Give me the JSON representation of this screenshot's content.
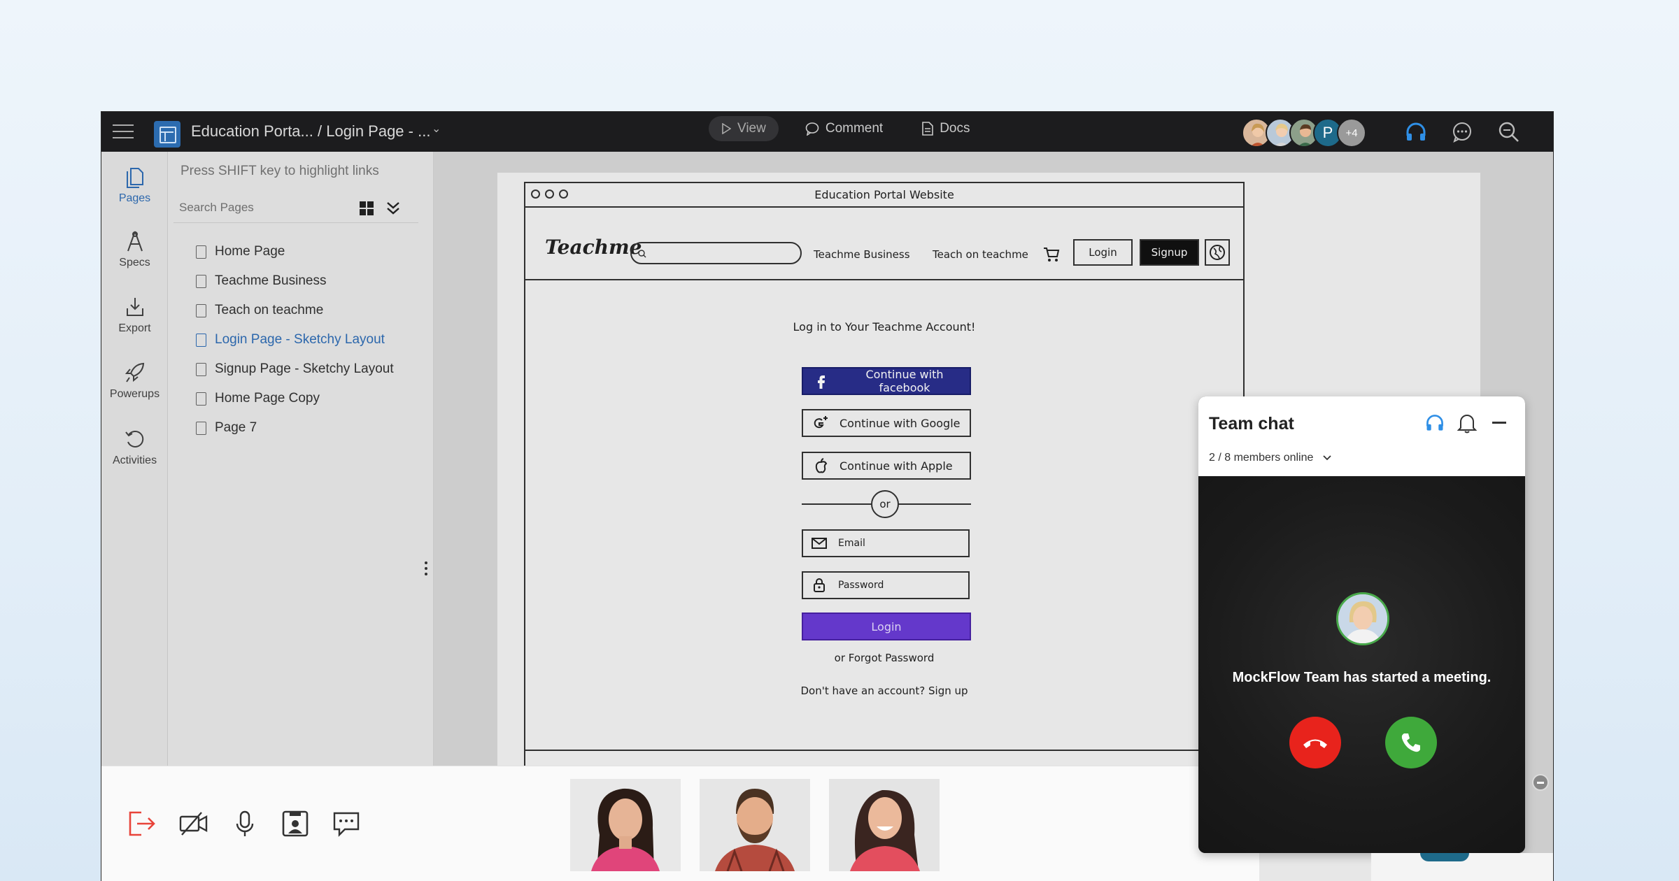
{
  "topbar": {
    "title": "Education Porta... / Login Page - ...",
    "view_label": "View",
    "comment_label": "Comment",
    "docs_label": "Docs",
    "avatar_initial": "P",
    "avatar_more": "+4",
    "accent_color": "#2f6db6"
  },
  "rail": {
    "items": [
      {
        "label": "Pages",
        "icon": "pages-icon"
      },
      {
        "label": "Specs",
        "icon": "specs-icon"
      },
      {
        "label": "Export",
        "icon": "export-icon"
      },
      {
        "label": "Powerups",
        "icon": "rocket-icon"
      },
      {
        "label": "Activities",
        "icon": "history-icon"
      }
    ]
  },
  "pages_panel": {
    "hint": "Press SHIFT key to highlight links",
    "search_placeholder": "Search Pages",
    "pages": [
      "Home Page",
      "Teachme Business",
      "Teach on teachme",
      "Login Page - Sketchy Layout",
      "Signup Page - Sketchy Layout",
      "Home Page Copy",
      "Page 7"
    ],
    "active_index": 3
  },
  "mockup": {
    "window_title": "Education Portal Website",
    "brand": "Teachme",
    "nav_business": "Teachme Business",
    "nav_teach": "Teach on teachme",
    "login_btn": "Login",
    "signup_btn": "Signup",
    "heading": "Log in to Your Teachme Account!",
    "facebook": "Continue with facebook",
    "google": "Continue with Google",
    "apple": "Continue with Apple",
    "or": "or",
    "email": "Email",
    "password": "Password",
    "submit": "Login",
    "forgot": "or Forgot Password",
    "signup_prompt": "Don't have an account? Sign up"
  },
  "chat": {
    "title": "Team chat",
    "members": "2 / 8 members online",
    "message": "MockFlow Team has started a meeting.",
    "decline_color": "#e8231c",
    "accept_color": "#3fa93b"
  }
}
